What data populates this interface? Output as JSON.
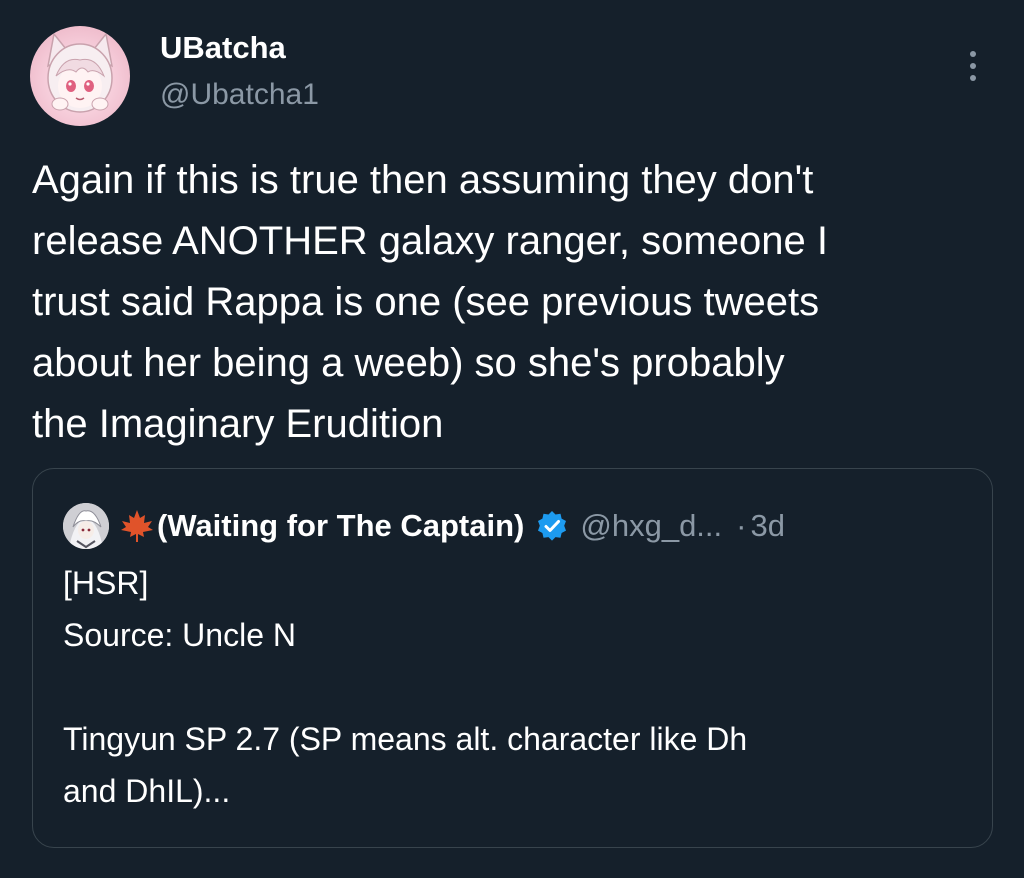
{
  "author": {
    "display_name": "UBatcha",
    "handle": "@Ubatcha1",
    "avatar_icon": "anime-avatar-icon"
  },
  "tweet": {
    "text": "Again if this is true then assuming they don't\nrelease ANOTHER galaxy ranger, someone I\ntrust said Rappa is one (see previous tweets\nabout her being a weeb) so she's probably\nthe Imaginary Erudition",
    "more_icon": "more-vertical-icon"
  },
  "quoted_tweet": {
    "name_emoji": "maple-leaf-icon",
    "display_name": "(Waiting for The Captain)",
    "verified_icon": "verified-badge-icon",
    "verified_color": "#1d9bf0",
    "handle": "@hxg_d...",
    "separator": "·",
    "time": "3d",
    "text": "[HSR]\nSource: Uncle N\n\nTingyun SP 2.7 (SP means alt. character like Dh\nand DhIL)..."
  },
  "colors": {
    "background": "#15202b",
    "text_primary": "#ffffff",
    "text_secondary": "#8b98a5",
    "border": "#38444d"
  }
}
